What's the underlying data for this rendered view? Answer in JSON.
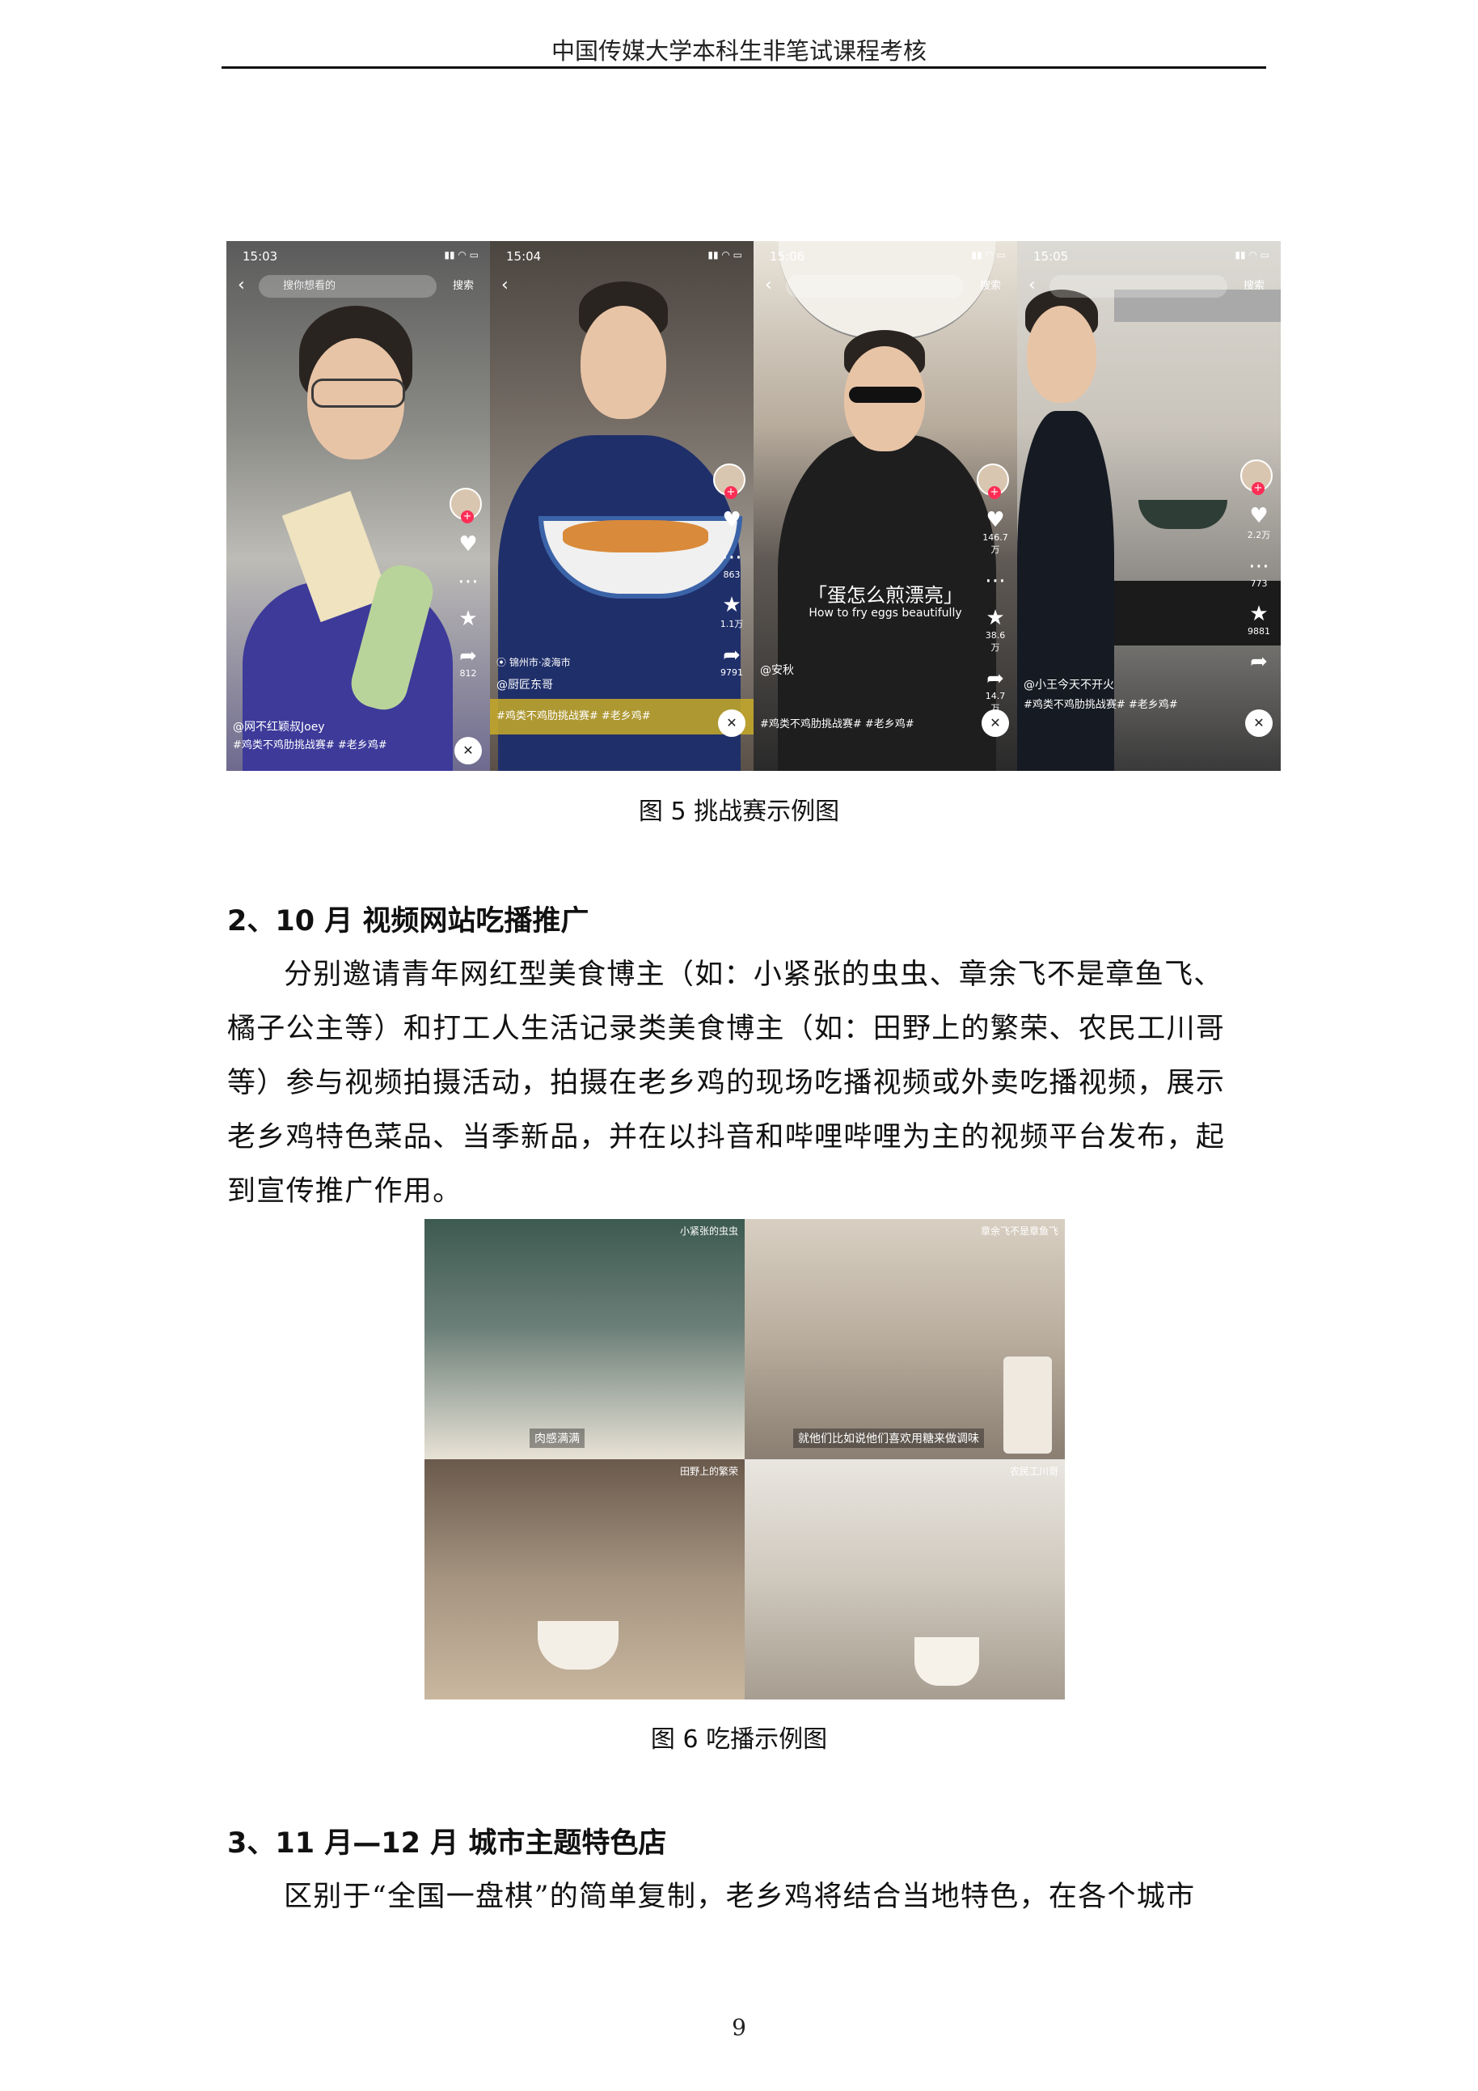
{
  "header": {
    "title": "中国传媒大学本科生非笔试课程考核"
  },
  "figure5": {
    "caption": "图 5 挑战赛示例图",
    "phones": [
      {
        "time": "15:03",
        "search": "搜你想看的",
        "search_btn": "搜索",
        "user": "@网不红颖叔Joey",
        "tag": "#鸡类不鸡肋挑战赛# #老乡鸡#",
        "counts": [
          "",
          "",
          "",
          "812"
        ]
      },
      {
        "time": "15:04",
        "search": "",
        "search_btn": "",
        "user": "@厨匠东哥",
        "location": "锦州市·凌海市",
        "tag": "#鸡类不鸡肋挑战赛# #老乡鸡#",
        "counts": [
          "",
          "863",
          "1.1万",
          "9791"
        ]
      },
      {
        "time": "15:06",
        "search": "",
        "search_btn": "搜索",
        "user": "@安秋",
        "subtitle": "「蛋怎么煎漂亮」",
        "subtitle_en": "How to fry eggs beautifully",
        "tag": "#鸡类不鸡肋挑战赛# #老乡鸡#",
        "counts": [
          "146.7万",
          "",
          "38.6万",
          "14.7万"
        ]
      },
      {
        "time": "15:05",
        "search": "",
        "search_btn": "搜索",
        "user": "@小王今天不开火",
        "tag": "#鸡类不鸡肋挑战赛# #老乡鸡#",
        "counts": [
          "2.2万",
          "773",
          "9881",
          ""
        ]
      }
    ]
  },
  "section2": {
    "heading": "2、10 月  视频网站吃播推广",
    "lines": [
      "分别邀请青年网红型美食博主（如：小紧张的虫虫、章余飞不是章鱼飞、",
      "橘子公主等）和打工人生活记录类美食博主（如：田野上的繁荣、农民工川哥",
      "等）参与视频拍摄活动，拍摄在老乡鸡的现场吃播视频或外卖吃播视频，展示",
      "老乡鸡特色菜品、当季新品，并在以抖音和哔哩哔哩为主的视频平台发布，起",
      "到宣传推广作用。"
    ]
  },
  "figure6": {
    "caption": "图 6 吃播示例图",
    "tiles": [
      {
        "label": "小紧张的虫虫",
        "sub": "肉感满满"
      },
      {
        "label": "章余飞不是章鱼飞",
        "sub": "就他们比如说他们喜欢用糖来做调味"
      },
      {
        "label": "田野上的繁荣",
        "sub": ""
      },
      {
        "label": "农民工川哥",
        "sub": ""
      }
    ]
  },
  "section3": {
    "heading": "3、11 月—12 月  城市主题特色店",
    "line": "区别于“全国一盘棋”的简单复制，老乡鸡将结合当地特色，在各个城市"
  },
  "page_number": "9",
  "colors": {
    "accent_pink": "#ff2d55",
    "tag_yellow": "#c8aa28"
  }
}
